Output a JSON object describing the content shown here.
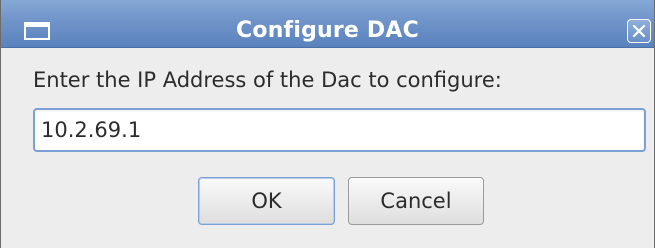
{
  "window": {
    "title": "Configure DAC"
  },
  "dialog": {
    "prompt": "Enter the IP Address of the Dac to configure:",
    "ip_value": "10.2.69.1",
    "ok_label": "OK",
    "cancel_label": "Cancel"
  },
  "icons": {
    "window": "window-icon",
    "close": "close-icon"
  },
  "colors": {
    "titlebar": "#6f94c9",
    "dialog_background": "#ededed",
    "focus_border": "#7aa0d6"
  }
}
